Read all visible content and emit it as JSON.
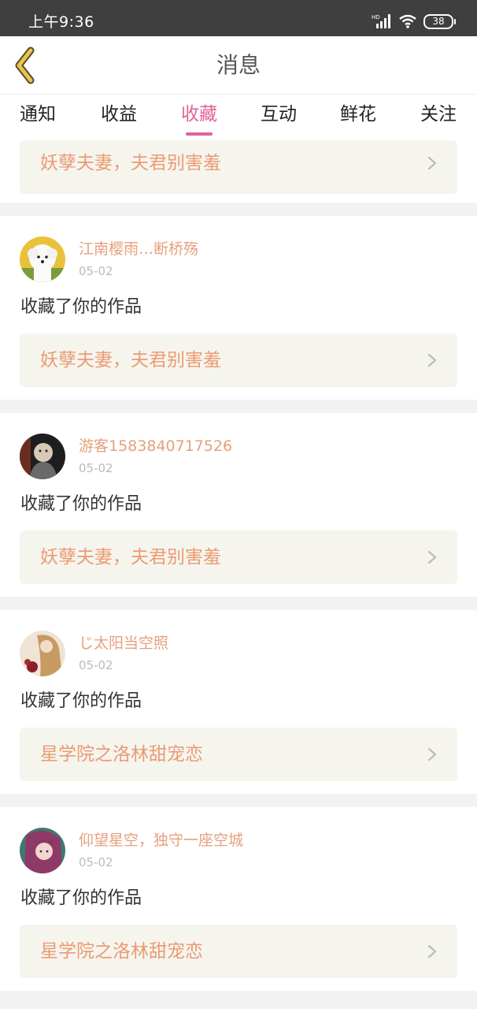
{
  "status": {
    "time": "上午9:36",
    "battery": "38",
    "network": "HD"
  },
  "nav": {
    "title": "消息"
  },
  "tabs": [
    {
      "label": "通知"
    },
    {
      "label": "收益"
    },
    {
      "label": "收藏"
    },
    {
      "label": "互动"
    },
    {
      "label": "鲜花"
    },
    {
      "label": "关注"
    }
  ],
  "active_tab": "收藏",
  "top_work": {
    "title": "妖孽夫妻，夫君别害羞"
  },
  "items": [
    {
      "user": "江南樱雨…断桥殇",
      "date": "05-02",
      "action": "收藏了你的作品",
      "work": "妖孽夫妻，夫君别害羞"
    },
    {
      "user": "游客1583840717526",
      "date": "05-02",
      "action": "收藏了你的作品",
      "work": "妖孽夫妻，夫君别害羞"
    },
    {
      "user": "じ太阳当空照",
      "date": "05-02",
      "action": "收藏了你的作品",
      "work": "星学院之洛林甜宠恋"
    },
    {
      "user": "仰望星空，独守一座空城",
      "date": "05-02",
      "action": "收藏了你的作品",
      "work": "星学院之洛林甜宠恋"
    }
  ],
  "colors": {
    "accent": "#e0629a",
    "link_text": "#ec9a73",
    "username": "#e5a07c",
    "back_arrow": "#e8c54a"
  },
  "icons": {
    "back": "back-arrow-icon",
    "row_arrow": "chevron-right-icon"
  }
}
